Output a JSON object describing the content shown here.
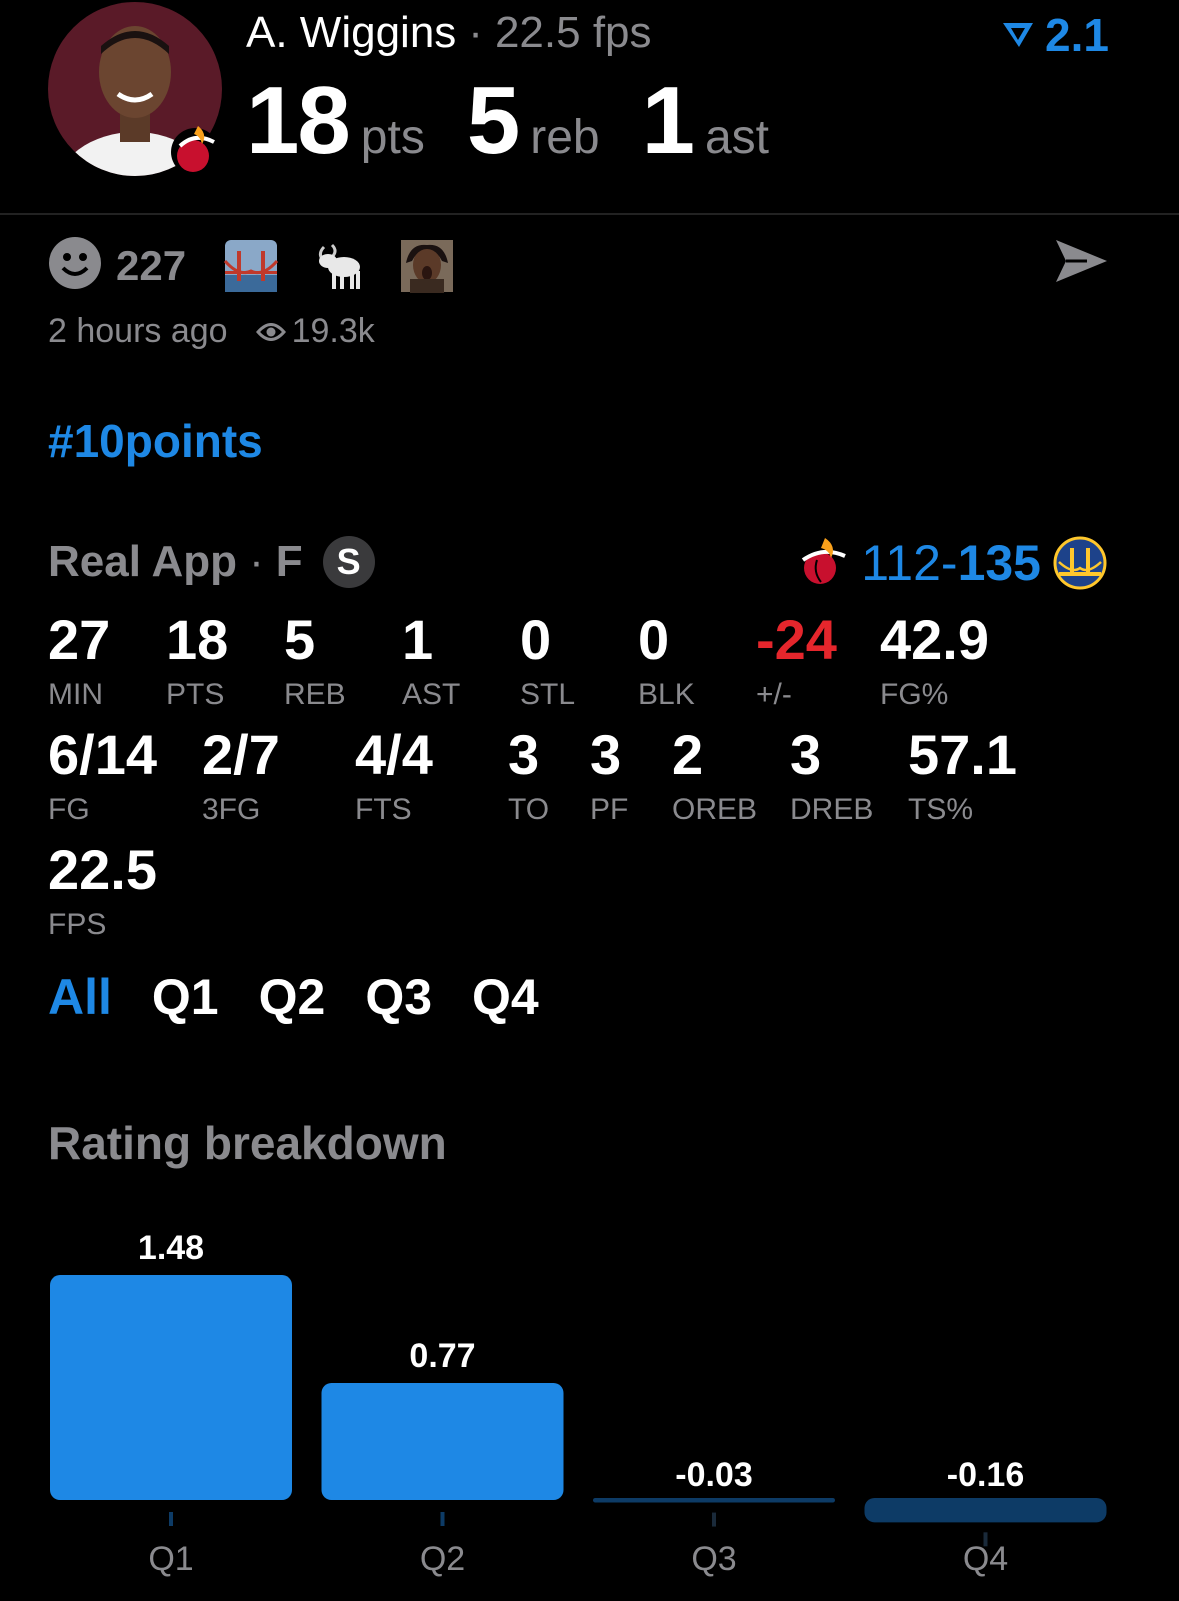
{
  "header": {
    "player_name": "A. Wiggins",
    "header_fps": "22.5 fps",
    "points": "18",
    "points_unit": "pts",
    "rebounds": "5",
    "rebounds_unit": "reb",
    "assists": "1",
    "assists_unit": "ast",
    "rating": "2.1"
  },
  "reactions": {
    "count": "227",
    "emojis": [
      "bridge-emoji",
      "goat-emoji",
      "shocked-person-emoji"
    ]
  },
  "meta": {
    "time_ago": "2 hours ago",
    "views": "19.3k"
  },
  "hashtag": "#10points",
  "game": {
    "source": "Real App",
    "status": "F",
    "badge": "S",
    "home_score": "112",
    "separator": "-",
    "away_score": "135"
  },
  "stats_row1": [
    {
      "value": "27",
      "label": "MIN"
    },
    {
      "value": "18",
      "label": "PTS"
    },
    {
      "value": "5",
      "label": "REB"
    },
    {
      "value": "1",
      "label": "AST"
    },
    {
      "value": "0",
      "label": "STL"
    },
    {
      "value": "0",
      "label": "BLK"
    },
    {
      "value": "-24",
      "label": "+/-"
    },
    {
      "value": "42.9",
      "label": "FG%"
    }
  ],
  "stats_row2": [
    {
      "value": "6/14",
      "label": "FG"
    },
    {
      "value": "2/7",
      "label": "3FG"
    },
    {
      "value": "4/4",
      "label": "FTS"
    },
    {
      "value": "3",
      "label": "TO"
    },
    {
      "value": "3",
      "label": "PF"
    },
    {
      "value": "2",
      "label": "OREB"
    },
    {
      "value": "3",
      "label": "DREB"
    },
    {
      "value": "57.1",
      "label": "TS%"
    }
  ],
  "stats_row3": [
    {
      "value": "22.5",
      "label": "FPS"
    }
  ],
  "tabs": [
    "All",
    "Q1",
    "Q2",
    "Q3",
    "Q4"
  ],
  "rating_breakdown_title": "Rating breakdown",
  "colors": {
    "accent": "#1e88e5",
    "negative": "#e5262c",
    "muted": "#8a8a8e",
    "bar_dark": "#0d3b66"
  },
  "chart_data": {
    "type": "bar",
    "title": "Rating breakdown",
    "categories": [
      "Q1",
      "Q2",
      "Q3",
      "Q4"
    ],
    "values": [
      1.48,
      0.77,
      -0.03,
      -0.16
    ],
    "value_labels": [
      "1.48",
      "0.77",
      "-0.03",
      "-0.16"
    ],
    "grid": false
  }
}
